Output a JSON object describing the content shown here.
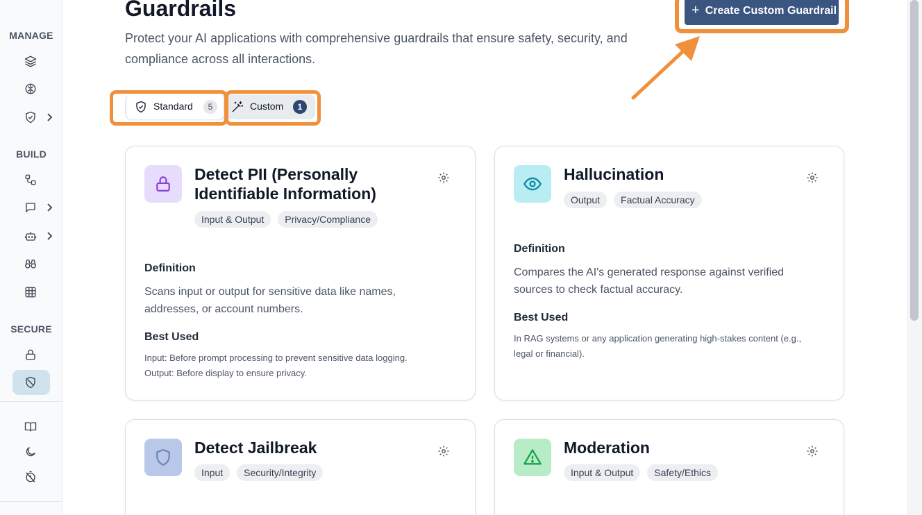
{
  "page": {
    "title": "Guardrails",
    "subtitle": "Protect your AI applications with comprehensive guardrails that ensure safety, security, and compliance across all interactions.",
    "create_button_label": "Create Custom Guardrail"
  },
  "sidebar": {
    "sections": [
      {
        "label": "MANAGE"
      },
      {
        "label": "BUILD"
      },
      {
        "label": "SECURE"
      }
    ],
    "items": [
      {
        "icon": "layers-icon"
      },
      {
        "icon": "brain-icon"
      },
      {
        "icon": "shield-check-icon",
        "has_chevron": true
      },
      {
        "icon": "workflow-icon"
      },
      {
        "icon": "chat-icon",
        "has_chevron": true
      },
      {
        "icon": "bot-icon",
        "has_chevron": true
      },
      {
        "icon": "binoculars-icon"
      },
      {
        "icon": "grid-icon"
      },
      {
        "icon": "lock-icon"
      },
      {
        "icon": "shield-off-icon",
        "active": true
      },
      {
        "icon": "book-icon"
      },
      {
        "icon": "moon-icon"
      },
      {
        "icon": "timer-off-icon"
      }
    ]
  },
  "tabs": [
    {
      "label": "Standard",
      "count": "5",
      "icon": "shield-icon",
      "selected": true
    },
    {
      "label": "Custom",
      "count": "1",
      "icon": "magic-wand-icon",
      "selected": false
    }
  ],
  "cards": [
    {
      "title": "Detect PII (Personally Identifiable Information)",
      "icon": "lock-icon",
      "icon_bg": "#e7dcfb",
      "icon_color": "#8b3fd9",
      "tags": [
        "Input & Output",
        "Privacy/Compliance"
      ],
      "definition_heading": "Definition",
      "definition": "Scans input or output for sensitive data like names, addresses, or account numbers.",
      "best_used_heading": "Best Used",
      "best_used": [
        "Input: Before prompt processing to prevent sensitive data logging.",
        "Output: Before display to ensure privacy."
      ]
    },
    {
      "title": "Hallucination",
      "icon": "eye-icon",
      "icon_bg": "#b9ecf3",
      "icon_color": "#0e8aa5",
      "tags": [
        "Output",
        "Factual Accuracy"
      ],
      "definition_heading": "Definition",
      "definition": "Compares the AI's generated response against verified sources to check factual accuracy.",
      "best_used_heading": "Best Used",
      "best_used": [
        "In RAG systems or any application generating high-stakes content (e.g., legal or financial)."
      ]
    },
    {
      "title": "Detect Jailbreak",
      "icon": "shield-icon",
      "icon_bg": "#b9c7e8",
      "icon_color": "#6f83b8",
      "tags": [
        "Input",
        "Security/Integrity"
      ]
    },
    {
      "title": "Moderation",
      "icon": "warning-icon",
      "icon_bg": "#b8ecc6",
      "icon_color": "#18a34a",
      "tags": [
        "Input & Output",
        "Safety/Ethics"
      ]
    }
  ],
  "colors": {
    "accent": "#3a557f",
    "highlight": "#f0903a",
    "active_nav": "#cfe3ef"
  }
}
